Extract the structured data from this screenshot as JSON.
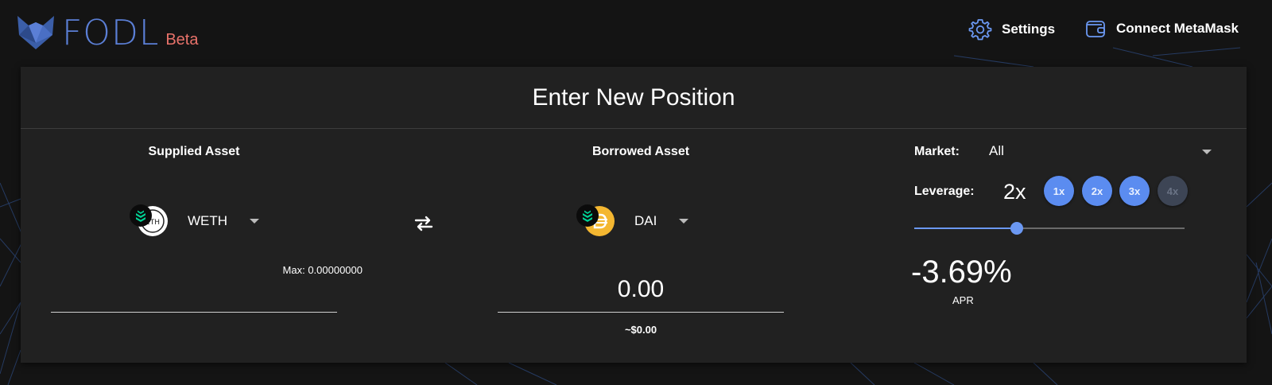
{
  "app": {
    "name": "FODL",
    "badge": "Beta"
  },
  "header": {
    "settings_label": "Settings",
    "connect_label": "Connect MetaMask"
  },
  "position_card": {
    "title": "Enter New Position",
    "supplied": {
      "title": "Supplied Asset",
      "asset": "WETH",
      "protocol_icon": "compound-icon",
      "token_icon": "weth-icon",
      "max_text": "Max: 0.00000000",
      "amount_value": ""
    },
    "swap_icon": "swap-arrows-icon",
    "borrowed": {
      "title": "Borrowed Asset",
      "asset": "DAI",
      "protocol_icon": "compound-icon",
      "token_icon": "dai-icon",
      "amount_value": "0.00",
      "usd_text": "~$0.00"
    },
    "market": {
      "label": "Market:",
      "selected": "All"
    },
    "leverage": {
      "label": "Leverage:",
      "value": "2x",
      "chips": [
        {
          "label": "1x",
          "enabled": true
        },
        {
          "label": "2x",
          "enabled": true
        },
        {
          "label": "3x",
          "enabled": true
        },
        {
          "label": "4x",
          "enabled": false
        }
      ],
      "slider_fraction": 0.38
    },
    "apr": {
      "value": "-3.69%",
      "label": "APR"
    }
  },
  "colors": {
    "accent": "#5b8cf0",
    "logo": "#5b7fd6",
    "beta": "#e8726a",
    "card_bg": "#212121",
    "page_bg": "#141414"
  }
}
